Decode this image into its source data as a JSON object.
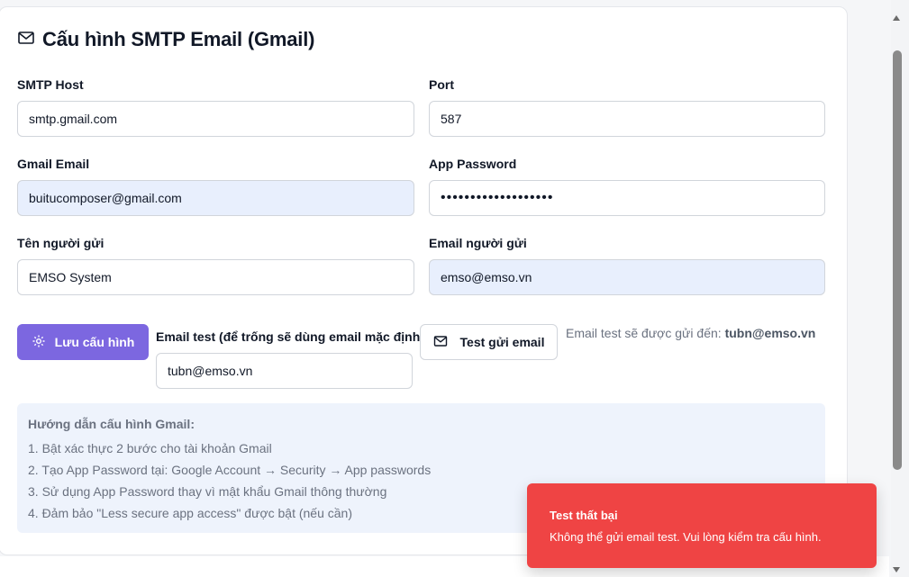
{
  "page": {
    "title": "Cấu hình SMTP Email (Gmail)",
    "title_icon": "mail-icon"
  },
  "form": {
    "smtp_host": {
      "label": "SMTP Host",
      "value": "smtp.gmail.com"
    },
    "port": {
      "label": "Port",
      "value": "587"
    },
    "gmail_email": {
      "label": "Gmail Email",
      "value": "buitucomposer@gmail.com"
    },
    "app_password": {
      "label": "App Password",
      "value": "•••••••••••••••••••"
    },
    "sender_name": {
      "label": "Tên người gửi",
      "value": "EMSO System"
    },
    "sender_email": {
      "label": "Email người gửi",
      "value": "emso@emso.vn"
    },
    "test_email": {
      "label": "Email test (để trống sẽ dùng email mặc định)",
      "value": "tubn@emso.vn"
    }
  },
  "actions": {
    "save_label": "Lưu cấu hình",
    "save_icon": "gear-icon",
    "test_label": "Test gửi email",
    "test_icon": "mail-icon"
  },
  "hint": {
    "prefix": "Email test sẽ được gửi đến: ",
    "email": "tubn@emso.vn"
  },
  "guide": {
    "title": "Hướng dẫn cấu hình Gmail:",
    "steps": [
      "1. Bật xác thực 2 bước cho tài khoản Gmail",
      "2. Tạo App Password tại: Google Account → Security → App passwords",
      "3. Sử dụng App Password thay vì mật khẩu Gmail thông thường",
      "4. Đảm bảo \"Less secure app access\" được bật (nếu cần)"
    ]
  },
  "toast": {
    "title": "Test thất bại",
    "message": "Không thể gửi email test. Vui lòng kiểm tra cấu hình."
  },
  "colors": {
    "primary": "#7c67e0",
    "error": "#ef4444",
    "filled_input": "#e8effd",
    "guide_bg": "#eef3fc"
  }
}
